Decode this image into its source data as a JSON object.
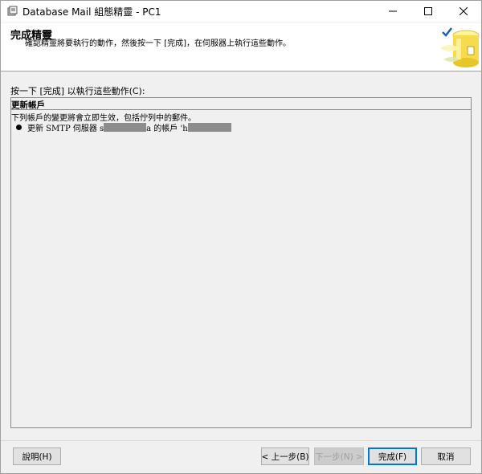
{
  "window": {
    "title": "Database Mail 組態精靈 - PC1",
    "minimize_glyph": "—",
    "maximize_glyph": "☐",
    "close_glyph": "✕"
  },
  "header": {
    "title": "完成精靈",
    "subtitle": "確認精靈將要執行的動作，然後按一下 [完成]，在伺服器上執行這些動作。"
  },
  "instruction": "按一下 [完成] 以執行這些動作(C):",
  "summary": {
    "section_title": "更新帳戶",
    "description": "下列帳戶的變更將會立即生效，包括佇列中的郵件。",
    "action_prefix": "更新 SMTP 伺服器 s",
    "action_middle": "a 的帳戶 'h",
    "action_suffix": ""
  },
  "buttons": {
    "help": "說明(H)",
    "back": "< 上一步(B)",
    "next": "下一步(N) >",
    "finish": "完成(F)",
    "cancel": "取消"
  },
  "icons": {
    "app": "database-mail-icon",
    "wizard": "database-wizard-icon"
  },
  "colors": {
    "accent": "#0078d7",
    "panel": "#f0f0f0",
    "redaction": "#8c8c8c"
  }
}
